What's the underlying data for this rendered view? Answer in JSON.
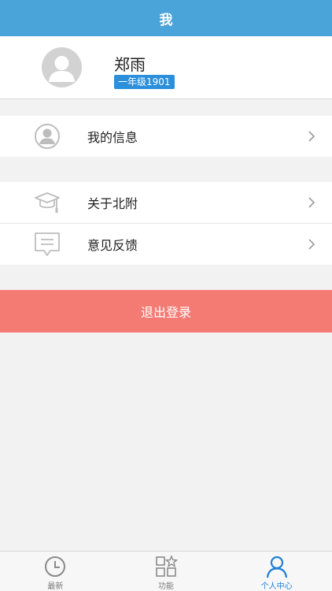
{
  "nav": {
    "title": "我"
  },
  "profile": {
    "name": "郑雨",
    "class_label": "一年级1901"
  },
  "menu": {
    "groups": [
      {
        "items": [
          {
            "label": "我的信息",
            "icon": "user-circle-icon"
          }
        ]
      },
      {
        "items": [
          {
            "label": "关于北附",
            "icon": "graduation-cap-icon"
          },
          {
            "label": "意见反馈",
            "icon": "feedback-message-icon"
          }
        ]
      }
    ]
  },
  "logout": {
    "label": "退出登录"
  },
  "tabbar": {
    "tabs": [
      {
        "label": "最新",
        "icon": "clock-icon"
      },
      {
        "label": "功能",
        "icon": "grid-star-icon"
      },
      {
        "label": "个人中心",
        "icon": "person-icon",
        "active": true
      }
    ]
  },
  "colors": {
    "nav_bg": "#4aa3d9",
    "badge_bg": "#2b8fdc",
    "logout_bg": "#f47b74",
    "tab_active": "#1e7fd6"
  }
}
